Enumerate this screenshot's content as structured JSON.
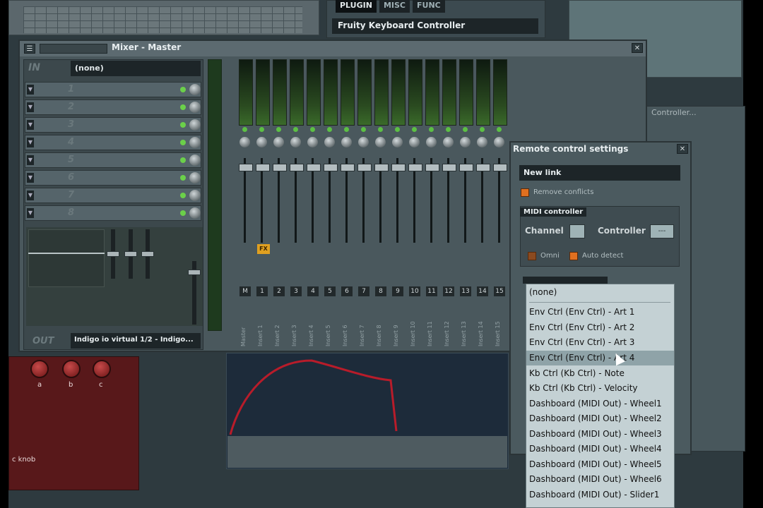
{
  "mixer": {
    "title": "Mixer - Master",
    "in_label": "IN",
    "in_value": "(none)",
    "fx_slots": [
      "1",
      "2",
      "3",
      "4",
      "5",
      "6",
      "7",
      "8"
    ],
    "out_label": "OUT",
    "out_value": "Indigo io virtual 1/2 - Indigo...",
    "fx_badge": "FX",
    "tracks": [
      {
        "num": "M",
        "name": "Master"
      },
      {
        "num": "1",
        "name": "Insert 1"
      },
      {
        "num": "2",
        "name": "Insert 2"
      },
      {
        "num": "3",
        "name": "Insert 3"
      },
      {
        "num": "4",
        "name": "Insert 4"
      },
      {
        "num": "5",
        "name": "Insert 5"
      },
      {
        "num": "6",
        "name": "Insert 6"
      },
      {
        "num": "7",
        "name": "Insert 7"
      },
      {
        "num": "8",
        "name": "Insert 8"
      },
      {
        "num": "9",
        "name": "Insert 9"
      },
      {
        "num": "10",
        "name": "Insert 10"
      },
      {
        "num": "11",
        "name": "Insert 11"
      },
      {
        "num": "12",
        "name": "Insert 12"
      },
      {
        "num": "13",
        "name": "Insert 13"
      },
      {
        "num": "14",
        "name": "Insert 14"
      },
      {
        "num": "15",
        "name": "Insert 15"
      }
    ]
  },
  "plugin": {
    "tabs": [
      "PLUGIN",
      "MISC",
      "FUNC"
    ],
    "name": "Fruity Keyboard Controller"
  },
  "background": {
    "controller_title": "Controller...",
    "left_knob_labels": [
      "a",
      "b",
      "c"
    ],
    "left_text": "c knob"
  },
  "remote": {
    "title": "Remote control settings",
    "link_value": "New link",
    "remove_conflicts": "Remove conflicts",
    "midi_section": "MIDI controller",
    "channel_label": "Channel",
    "controller_label": "Controller",
    "controller_value": "---",
    "omni_label": "Omni",
    "auto_detect_label": "Auto detect"
  },
  "dropdown": {
    "items": [
      "(none)",
      "Env Ctrl (Env Ctrl) - Art 1",
      "Env Ctrl (Env Ctrl) - Art 2",
      "Env Ctrl (Env Ctrl) - Art 3",
      "Env Ctrl (Env Ctrl) - Art 4",
      "Kb Ctrl (Kb Ctrl) - Note",
      "Kb Ctrl (Kb Ctrl) - Velocity",
      "Dashboard (MIDI Out) - Wheel1",
      "Dashboard (MIDI Out) - Wheel2",
      "Dashboard (MIDI Out) - Wheel3",
      "Dashboard (MIDI Out) - Wheel4",
      "Dashboard (MIDI Out) - Wheel5",
      "Dashboard (MIDI Out) - Wheel6",
      "Dashboard (MIDI Out) - Slider1"
    ],
    "highlighted_index": 4
  }
}
